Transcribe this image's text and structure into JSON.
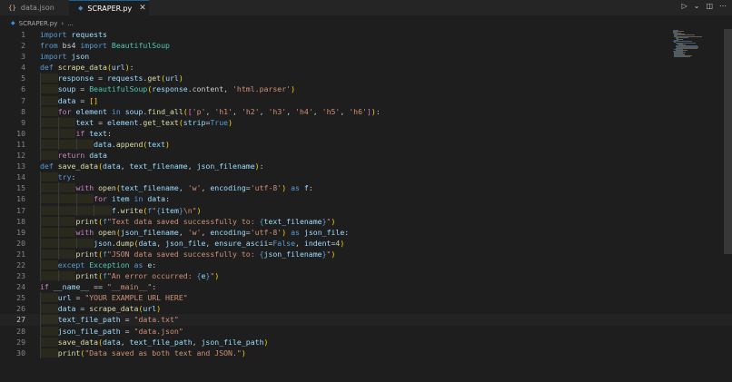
{
  "tabs": [
    {
      "icon": "{}",
      "label": "data.json",
      "active": false
    },
    {
      "icon": "◆",
      "label": "SCRAPER.py",
      "active": true,
      "close": "✕"
    }
  ],
  "breadcrumb": {
    "file": "SCRAPER.py",
    "rest": "..."
  },
  "actions": {
    "run": "▷",
    "run_menu": "⌄",
    "split": "◫",
    "more": "⋯"
  },
  "editor": {
    "current_line": 27,
    "lines": [
      {
        "n": "1",
        "indent": 0,
        "code": "import requests"
      },
      {
        "n": "2",
        "indent": 0,
        "code": "from bs4 import BeautifulSoup"
      },
      {
        "n": "3",
        "indent": 0,
        "code": "import json"
      },
      {
        "n": "4",
        "indent": 0,
        "code": "def scrape_data(url):"
      },
      {
        "n": "5",
        "indent": 1,
        "code": "    response = requests.get(url)"
      },
      {
        "n": "6",
        "indent": 1,
        "code": "    soup = BeautifulSoup(response.content, 'html.parser')"
      },
      {
        "n": "7",
        "indent": 1,
        "code": "    data = []"
      },
      {
        "n": "8",
        "indent": 1,
        "code": "    for element in soup.find_all(['p', 'h1', 'h2', 'h3', 'h4', 'h5', 'h6']):"
      },
      {
        "n": "9",
        "indent": 2,
        "code": "        text = element.get_text(strip=True)"
      },
      {
        "n": "10",
        "indent": 2,
        "code": "        if text:"
      },
      {
        "n": "11",
        "indent": 3,
        "code": "            data.append(text)"
      },
      {
        "n": "12",
        "indent": 1,
        "code": "    return data"
      },
      {
        "n": "13",
        "indent": 0,
        "code": "def save_data(data, text_filename, json_filename):"
      },
      {
        "n": "14",
        "indent": 1,
        "code": "    try:"
      },
      {
        "n": "15",
        "indent": 2,
        "code": "        with open(text_filename, 'w', encoding='utf-8') as f:"
      },
      {
        "n": "16",
        "indent": 3,
        "code": "            for item in data:"
      },
      {
        "n": "17",
        "indent": 4,
        "code": "                f.write(f\"{item}\\n\")"
      },
      {
        "n": "18",
        "indent": 2,
        "code": "        print(f\"Text data saved successfully to: {text_filename}\")"
      },
      {
        "n": "19",
        "indent": 2,
        "code": "        with open(json_filename, 'w', encoding='utf-8') as json_file:"
      },
      {
        "n": "20",
        "indent": 3,
        "code": "            json.dump(data, json_file, ensure_ascii=False, indent=4)"
      },
      {
        "n": "21",
        "indent": 2,
        "code": "        print(f\"JSON data saved successfully to: {json_filename}\")"
      },
      {
        "n": "22",
        "indent": 1,
        "code": "    except Exception as e:"
      },
      {
        "n": "23",
        "indent": 2,
        "code": "        print(f\"An error occurred: {e}\")"
      },
      {
        "n": "24",
        "indent": 0,
        "code": "if __name__ == \"__main__\":"
      },
      {
        "n": "25",
        "indent": 1,
        "code": "    url = \"YOUR EXAMPLE URL HERE\""
      },
      {
        "n": "26",
        "indent": 1,
        "code": "    data = scrape_data(url)"
      },
      {
        "n": "27",
        "indent": 1,
        "code": "    text_file_path = \"data.txt\""
      },
      {
        "n": "28",
        "indent": 1,
        "code": "    json_file_path = \"data.json\""
      },
      {
        "n": "29",
        "indent": 1,
        "code": "    save_data(data, text_file_path, json_file_path)"
      },
      {
        "n": "30",
        "indent": 1,
        "code": "    print(\"Data saved as both text and JSON.\")"
      }
    ]
  },
  "colors": {
    "background": "#1e1e1e",
    "tabbar": "#252526",
    "keyword": "#569cd6",
    "control": "#c586c0",
    "function": "#dcdcaa",
    "variable": "#9cdcfe",
    "string": "#ce9178",
    "class": "#4ec9b0",
    "number": "#b5cea8"
  }
}
